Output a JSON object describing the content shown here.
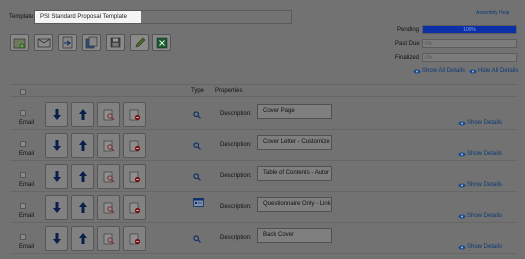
{
  "header": {
    "template_label": "Template:",
    "template_value": "PSI Standard Proposal Template",
    "assembly_help": "Assembly Help"
  },
  "toolbar": {
    "icons": [
      "add-document-icon",
      "email-icon",
      "export-document-icon",
      "copy-document-icon",
      "save-icon",
      "edit-icon",
      "excel-icon"
    ]
  },
  "status": {
    "pending_label": "Pending",
    "pending_value": "100%",
    "pending_fraction": 1.0,
    "pastdue_label": "Past Due",
    "pastdue_value": "0%",
    "finalized_label": "Finalized",
    "finalized_value": "0%",
    "bar_color": "#0a2fa6"
  },
  "details_links": {
    "show_all": "Show All Details",
    "hide_all": "Hide All Details"
  },
  "columns": {
    "type": "Type",
    "properties": "Properties"
  },
  "row_common": {
    "email_label": "Email",
    "description_label": "Description:",
    "show_details": "Show Details"
  },
  "rows": [
    {
      "description": "Cover Page",
      "type_icon": "magnifier-icon"
    },
    {
      "description": "Cover Letter - Customize",
      "type_icon": "magnifier-icon"
    },
    {
      "description": "Table of Contents - Autor",
      "type_icon": "magnifier-icon"
    },
    {
      "description": "Questionnaire Only - Link",
      "type_icon": "questionnaire-icon"
    },
    {
      "description": "Back Cover",
      "type_icon": "magnifier-icon"
    }
  ]
}
